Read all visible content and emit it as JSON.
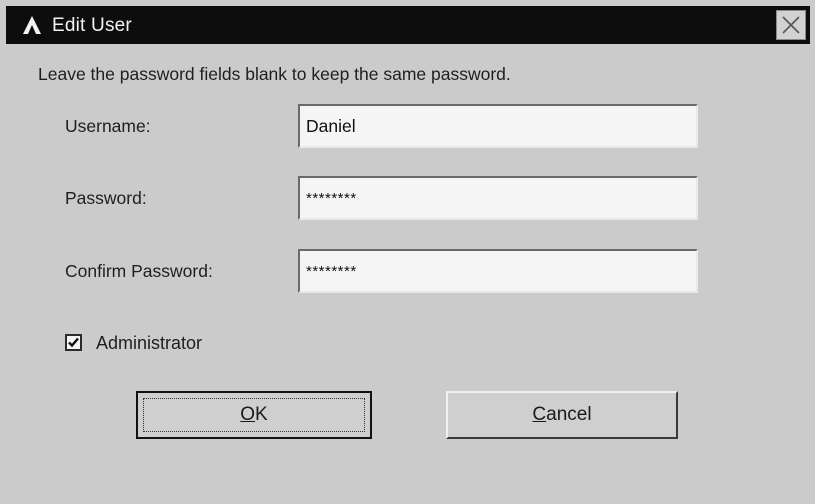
{
  "window": {
    "title": "Edit User",
    "close_icon": "close-icon",
    "app_icon": "app-logo-icon"
  },
  "notice": "Leave the password fields blank to keep the same password.",
  "form": {
    "username_label": "Username:",
    "username_value": "Daniel",
    "password_label": "Password:",
    "password_value": "********",
    "confirm_label": "Confirm Password:",
    "confirm_value": "********",
    "admin_label": "Administrator",
    "admin_checked": true
  },
  "buttons": {
    "ok_mnemonic": "O",
    "ok_rest": "K",
    "cancel_mnemonic": "C",
    "cancel_rest": "ancel"
  },
  "colors": {
    "dialog_bg": "#cbcbcb",
    "titlebar_bg": "#0d0d0d",
    "field_bg": "#f5f5f5"
  }
}
